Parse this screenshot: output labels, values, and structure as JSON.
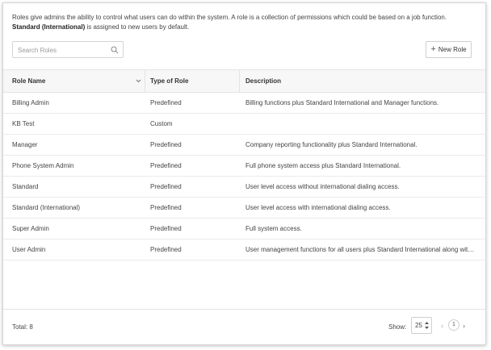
{
  "intro": {
    "line1": "Roles give admins the ability to control what users can do within the system. A role is a collection of permissions which could be based on a job function.",
    "line2_bold": "Standard (International)",
    "line2_rest": " is assigned to new users by default."
  },
  "search": {
    "placeholder": "Search Roles",
    "value": ""
  },
  "new_role_label": "New Role",
  "table": {
    "headers": [
      "Role Name",
      "Type of Role",
      "Description"
    ],
    "rows": [
      [
        "Billing Admin",
        "Predefined",
        "Billing functions plus Standard International and Manager functions."
      ],
      [
        "KB Test",
        "Custom",
        ""
      ],
      [
        "Manager",
        "Predefined",
        "Company reporting functionality plus Standard International."
      ],
      [
        "Phone System Admin",
        "Predefined",
        "Full phone system access plus Standard International."
      ],
      [
        "Standard",
        "Predefined",
        "User level access without international dialing access."
      ],
      [
        "Standard (International)",
        "Predefined",
        "User level access with international dialing access."
      ],
      [
        "Super Admin",
        "Predefined",
        "Full system access."
      ],
      [
        "User Admin",
        "Predefined",
        "User management functions for all users plus Standard International along with..."
      ]
    ]
  },
  "footer": {
    "total": "Total: 8",
    "show_label": "Show:",
    "page_size": "25",
    "current_page": "1"
  },
  "icons": {
    "search": "search-icon",
    "sort": "chevron-down-icon",
    "add": "plus-icon",
    "prev": "chevron-left-icon",
    "next": "chevron-right-icon"
  }
}
